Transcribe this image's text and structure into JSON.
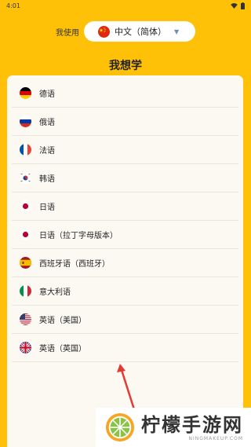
{
  "status_bar": {
    "time": "4:01"
  },
  "header": {
    "native_label": "我使用",
    "native_language": {
      "label": "中文（简体）",
      "flag": "china-flag"
    }
  },
  "title": "我想学",
  "languages": [
    {
      "label": "德语",
      "flag": "germany-flag"
    },
    {
      "label": "俄语",
      "flag": "russia-flag"
    },
    {
      "label": "法语",
      "flag": "france-flag"
    },
    {
      "label": "韩语",
      "flag": "south-korea-flag"
    },
    {
      "label": "日语",
      "flag": "japan-flag"
    },
    {
      "label": "日语（拉丁字母版本）",
      "flag": "japan-flag"
    },
    {
      "label": "西班牙语（西班牙）",
      "flag": "spain-flag"
    },
    {
      "label": "意大利语",
      "flag": "italy-flag"
    },
    {
      "label": "英语（美国）",
      "flag": "usa-flag"
    },
    {
      "label": "英语（英国）",
      "flag": "uk-flag"
    }
  ],
  "watermark": {
    "title": "柠檬手游网",
    "subtitle": "NINGMAKEUP.COM"
  },
  "colors": {
    "background": "#FFC107",
    "card": "#FBF9F2",
    "arrow": "#E53935"
  }
}
